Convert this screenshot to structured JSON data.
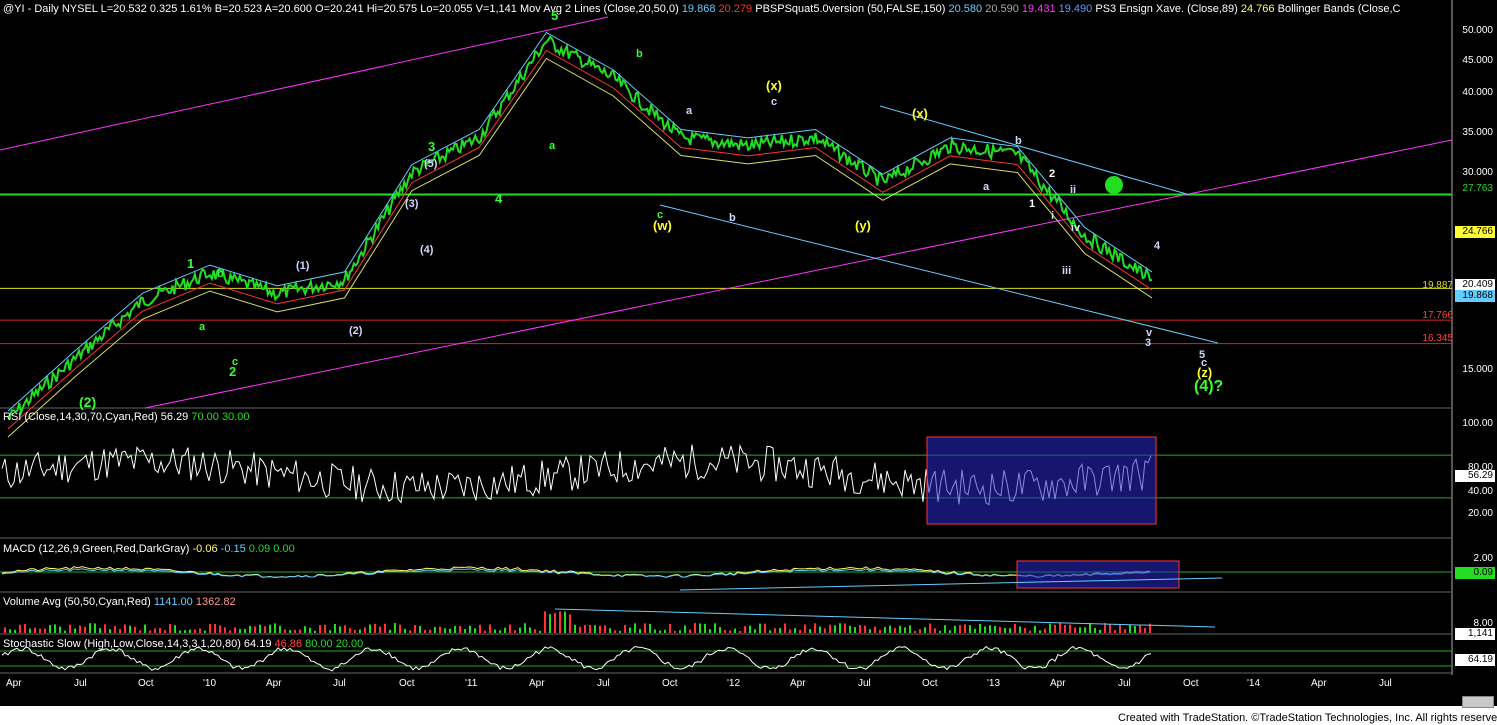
{
  "header": {
    "symbol": "@YI - Daily  NYSEL",
    "last": "L=20.532",
    "chg": "0.325",
    "pct": "1.61%",
    "bid": "B=20.523",
    "ask": "A=20.600",
    "open": "O=20.241",
    "hi": "Hi=20.575",
    "lo": "Lo=20.055",
    "vol": "V=1,141",
    "ma_label": "Mov Avg 2 Lines (Close,20,50,0)",
    "ma1": "19.868",
    "ma2": "20.279",
    "pbs_label": "PBSPSquat5.0version (50,FALSE,150)",
    "pbs1": "20.580",
    "pbs2": "20.590",
    "pbs3": "19.431",
    "pbs4": "19.490",
    "ens_label": "PS3 Ensign Xave. (Close,89)",
    "ens_val": "24.766",
    "bb_label": "Bollinger Bands (Close,C"
  },
  "price_axis": [
    "50.000",
    "45.000",
    "40.000",
    "35.000",
    "30.000",
    "15.000"
  ],
  "price_tags": {
    "t1": "27.763",
    "t2": "24.766",
    "t3": "20.409",
    "t4": "19.887",
    "t5": "17.766",
    "t6": "16.345",
    "t7": "19.868"
  },
  "rsi": {
    "label": "RSI (Close,14,30,70,Cyan,Red)",
    "val": "56.29",
    "ob": "70.00",
    "os": "30.00",
    "axis": [
      "100.00",
      "80.00",
      "40.00",
      "20.00"
    ],
    "tag": "56.29"
  },
  "macd": {
    "label": "MACD (12,26,9,Green,Red,DarkGray)",
    "v1": "-0.06",
    "v2": "-0.15",
    "v3": "0.09",
    "v4": "0.00",
    "axis": [
      "2.00"
    ],
    "tag": "0.09"
  },
  "volume": {
    "label": "Volume Avg (50,50,Cyan,Red)",
    "v1": "1141.00",
    "v2": "1362.82",
    "axis": [
      "8.00"
    ],
    "tag": "1,141"
  },
  "stoch": {
    "label": "Stochastic Slow (High,Low,Close,14,3,3,1,20,80)",
    "v1": "64.19",
    "v2": "46.86",
    "v3": "80.00",
    "v4": "20.00",
    "tag": "64.19"
  },
  "x_axis": [
    "Apr",
    "Jul",
    "Oct",
    "'10",
    "Apr",
    "Jul",
    "Oct",
    "'11",
    "Apr",
    "Jul",
    "Oct",
    "'12",
    "Apr",
    "Jul",
    "Oct",
    "'13",
    "Apr",
    "Jul",
    "Oct",
    "'14",
    "Apr",
    "Jul"
  ],
  "waves": [
    {
      "t": "1",
      "c": "#33ff33"
    },
    {
      "t": "2",
      "c": "#33ff33"
    },
    {
      "t": "(2)",
      "c": "#33ff33"
    },
    {
      "t": "3",
      "c": "#33ff33"
    },
    {
      "t": "4",
      "c": "#33ff33"
    },
    {
      "t": "5",
      "c": "#33ff33"
    },
    {
      "t": "(1)",
      "c": "#cfd8ff"
    },
    {
      "t": "(2)",
      "c": "#cfd8ff"
    },
    {
      "t": "(3)",
      "c": "#cfd8ff"
    },
    {
      "t": "(4)",
      "c": "#cfd8ff"
    },
    {
      "t": "(5)",
      "c": "#cfd8ff"
    },
    {
      "t": "a",
      "c": "#33ff33"
    },
    {
      "t": "b",
      "c": "#33ff33"
    },
    {
      "t": "c",
      "c": "#33ff33"
    },
    {
      "t": "a",
      "c": "#cfd8ff"
    },
    {
      "t": "b",
      "c": "#cfd8ff"
    },
    {
      "t": "c",
      "c": "#cfd8ff"
    },
    {
      "t": "(w)",
      "c": "#ffff33"
    },
    {
      "t": "(x)",
      "c": "#ffff33"
    },
    {
      "t": "(y)",
      "c": "#ffff33"
    },
    {
      "t": "(x)",
      "c": "#ffff33"
    },
    {
      "t": "(z)",
      "c": "#ffff33"
    },
    {
      "t": "(4)?",
      "c": "#33ff33"
    },
    {
      "t": "a",
      "c": "#33ff33"
    },
    {
      "t": "b",
      "c": "#33ff33"
    },
    {
      "t": "c",
      "c": "#33ff33"
    },
    {
      "t": "b",
      "c": "#33ff33"
    },
    {
      "t": "a",
      "c": "#cfd8ff"
    },
    {
      "t": "b",
      "c": "#cfd8ff"
    },
    {
      "t": "a",
      "c": "#cfd8ff"
    },
    {
      "t": "b",
      "c": "#cfd8ff"
    },
    {
      "t": "1",
      "c": "#fff"
    },
    {
      "t": "2",
      "c": "#fff"
    },
    {
      "t": "i",
      "c": "#cfd8ff"
    },
    {
      "t": "ii",
      "c": "#cfd8ff"
    },
    {
      "t": "iii",
      "c": "#cfd8ff"
    },
    {
      "t": "iv",
      "c": "#cfd8ff"
    },
    {
      "t": "v",
      "c": "#cfd8ff"
    },
    {
      "t": "3",
      "c": "#cfd8ff"
    },
    {
      "t": "4",
      "c": "#cfd8ff"
    },
    {
      "t": "5",
      "c": "#cfd8ff"
    },
    {
      "t": "c",
      "c": "#cfd8ff"
    }
  ],
  "credit": "Created with TradeStation. ©TradeStation Technologies, Inc. All rights reserved.",
  "chart_data": {
    "type": "line",
    "title": "@YI - Daily  NYSEL",
    "x": [
      "Apr",
      "Jul",
      "Oct",
      "'10",
      "Apr",
      "Jul",
      "Oct",
      "'11",
      "Apr",
      "Jul",
      "Oct",
      "'12",
      "Apr",
      "Jul",
      "Oct",
      "'13",
      "Apr",
      "Jul"
    ],
    "series": [
      {
        "name": "Close",
        "values": [
          12.5,
          15.5,
          19.0,
          21.0,
          19.5,
          20.5,
          30.0,
          34.0,
          48.0,
          42.0,
          34.0,
          33.0,
          34.0,
          29.0,
          33.0,
          32.0,
          24.0,
          20.5
        ]
      }
    ],
    "ylim": [
      13.0,
      52.0
    ],
    "hlines": [
      27.763,
      19.887,
      17.766,
      16.345
    ],
    "colors": {
      "price": "#22dd22",
      "hline_green": "#22dd22",
      "hline_yellow": "#dddd22",
      "hline_red": "#dd2222",
      "magenta": "#ff33ff",
      "cyan": "#66ccff"
    }
  }
}
